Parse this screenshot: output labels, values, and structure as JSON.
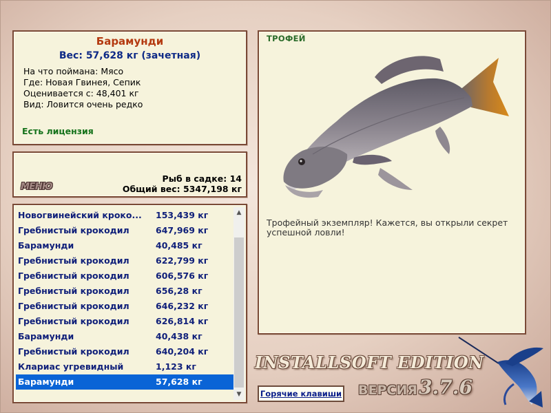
{
  "fish_info": {
    "name": "Барамунди",
    "weight_line": "Вес: 57,628 кг (зачетная)",
    "caught_with": "На что поймана: Мясо",
    "location": "Где: Новая Гвинея, Сепик",
    "valued_from": "Оценивается с: 48,401 кг",
    "rarity": "Вид: Ловится очень редко",
    "license": "Есть лицензия"
  },
  "menu": {
    "menu_label": "МЕНЮ",
    "fish_count": "Рыб в садке: 14",
    "total_weight": "Общий вес: 5347,198 кг"
  },
  "catch_list": [
    {
      "name": "Новогвинейский кроко...",
      "weight": "153,439 кг"
    },
    {
      "name": "Гребнистый крокодил",
      "weight": "647,969 кг"
    },
    {
      "name": "Барамунди",
      "weight": "40,485 кг"
    },
    {
      "name": "Гребнистый крокодил",
      "weight": "622,799 кг"
    },
    {
      "name": "Гребнистый крокодил",
      "weight": "606,576 кг"
    },
    {
      "name": "Гребнистый крокодил",
      "weight": "656,28 кг"
    },
    {
      "name": "Гребнистый крокодил",
      "weight": "646,232 кг"
    },
    {
      "name": "Гребнистый крокодил",
      "weight": "626,814 кг"
    },
    {
      "name": "Барамунди",
      "weight": "40,438 кг"
    },
    {
      "name": "Гребнистый крокодил",
      "weight": "640,204 кг"
    },
    {
      "name": "Клариас угревидный",
      "weight": "1,123 кг"
    },
    {
      "name": "Барамунди",
      "weight": "57,628 кг"
    }
  ],
  "selected_index": 11,
  "trophy": {
    "label": "ТРОФЕЙ",
    "description": "Трофейный экземпляр! Кажется, вы открыли секрет успешной ловли!"
  },
  "branding": {
    "edition": "INSTALLSOFT EDITION",
    "version_label": "ВЕРСИЯ",
    "version_number": "3.7.6",
    "hotkeys": "Горячие клавиши"
  },
  "colors": {
    "title": "#b43a10",
    "navy": "#10207a",
    "license": "#15721b",
    "selection": "#0a64d6"
  }
}
